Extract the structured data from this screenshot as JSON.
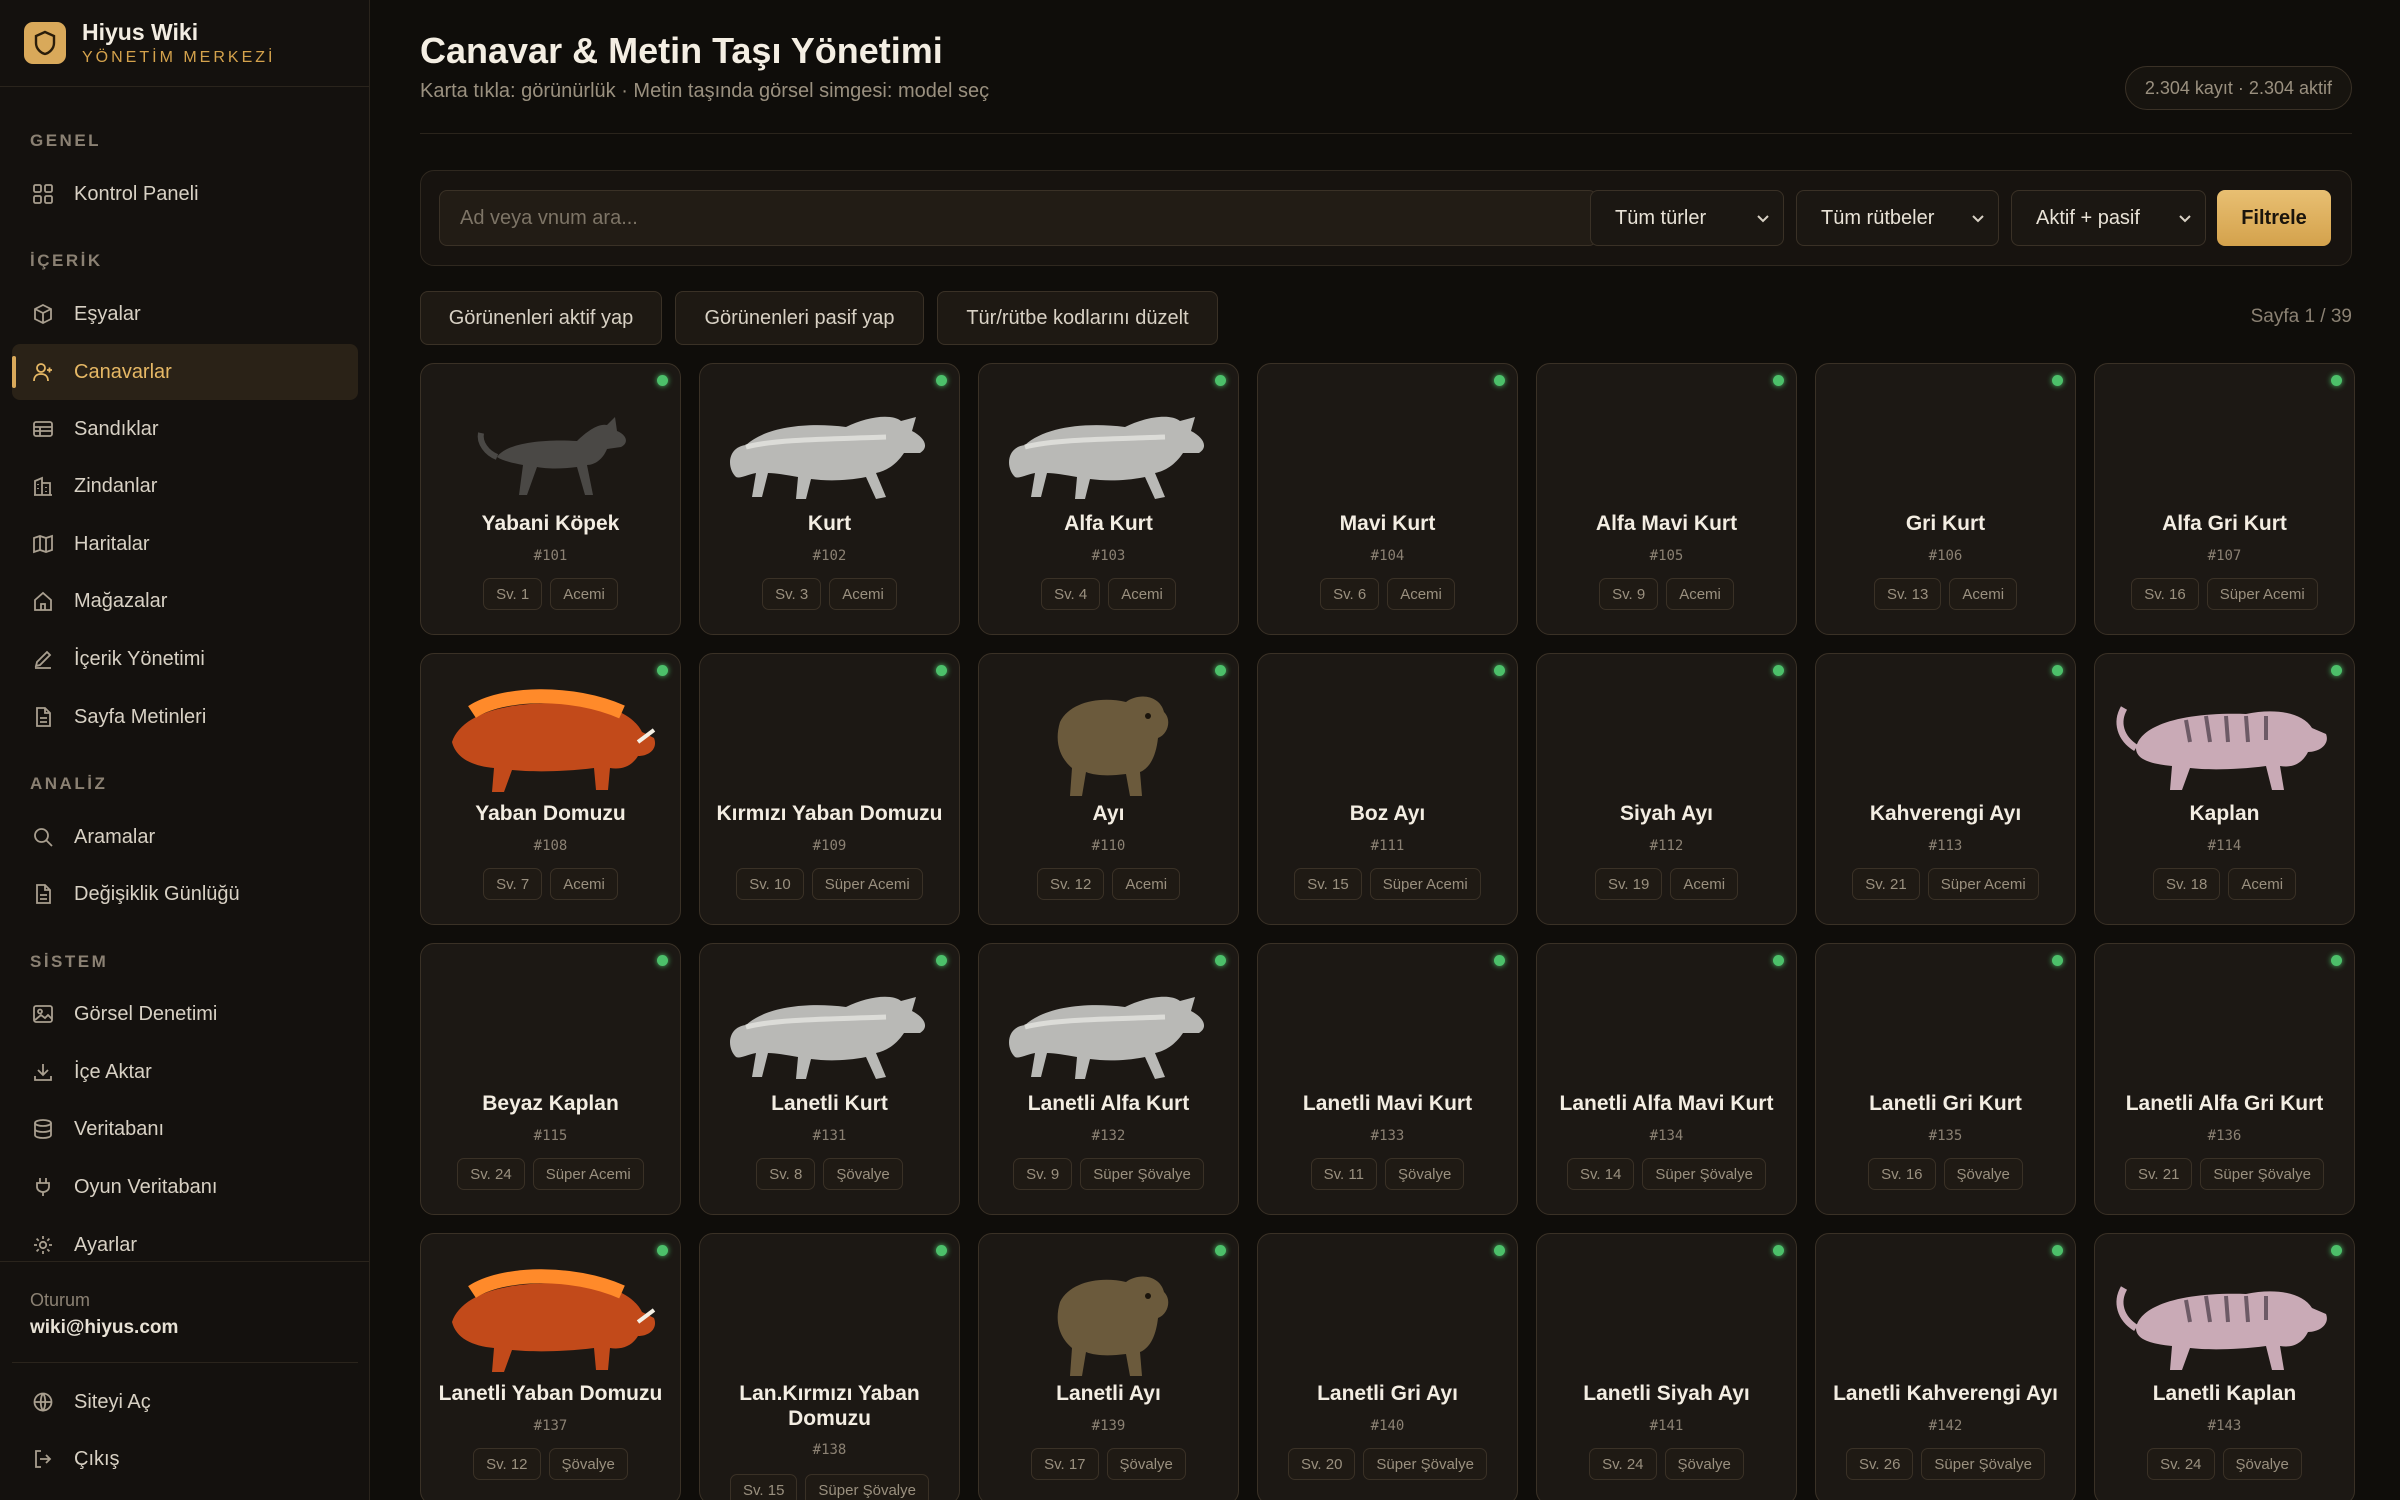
{
  "brand": {
    "title": "Hiyus Wiki",
    "subtitle": "YÖNETİM MERKEZİ"
  },
  "sidebar": {
    "sections": [
      "GENEL",
      "İÇERİK",
      "ANALİZ",
      "SİSTEM"
    ],
    "items": [
      {
        "label": "Kontrol Paneli",
        "icon": "grid-icon"
      },
      {
        "label": "Eşyalar",
        "icon": "box-icon"
      },
      {
        "label": "Canavarlar",
        "icon": "users-icon",
        "active": true
      },
      {
        "label": "Sandıklar",
        "icon": "chest-icon"
      },
      {
        "label": "Zindanlar",
        "icon": "building-icon"
      },
      {
        "label": "Haritalar",
        "icon": "map-icon"
      },
      {
        "label": "Mağazalar",
        "icon": "store-icon"
      },
      {
        "label": "İçerik Yönetimi",
        "icon": "pencil-icon"
      },
      {
        "label": "Sayfa Metinleri",
        "icon": "document-icon"
      },
      {
        "label": "Aramalar",
        "icon": "search-icon"
      },
      {
        "label": "Değişiklik Günlüğü",
        "icon": "document-icon"
      },
      {
        "label": "Görsel Denetimi",
        "icon": "image-icon"
      },
      {
        "label": "İçe Aktar",
        "icon": "download-icon"
      },
      {
        "label": "Veritabanı",
        "icon": "database-icon"
      },
      {
        "label": "Oyun Veritabanı",
        "icon": "plug-icon"
      },
      {
        "label": "Ayarlar",
        "icon": "gear-icon"
      }
    ],
    "session_label": "Oturum",
    "session_user": "wiki@hiyus.com",
    "bottom": [
      {
        "label": "Siteyi Aç",
        "icon": "globe-icon"
      },
      {
        "label": "Çıkış",
        "icon": "logout-icon"
      }
    ]
  },
  "header": {
    "title": "Canavar & Metin Taşı Yönetimi",
    "subtitle": "Karta tıkla: görünürlük · Metin taşında görsel simgesi: model seç",
    "count": "2.304 kayıt · 2.304 aktif"
  },
  "filters": {
    "search_placeholder": "Ad veya vnum ara...",
    "type": "Tüm türler",
    "rank": "Tüm rütbeler",
    "status": "Aktif + pasif",
    "submit": "Filtrele"
  },
  "actions": {
    "activate": "Görünenleri aktif yap",
    "deactivate": "Görünenleri pasif yap",
    "fix_codes": "Tür/rütbe kodlarını düzelt",
    "page": "Sayfa 1 / 39"
  },
  "colors": {
    "accent": "#d9a95a",
    "active_dot": "#4cc06a",
    "background": "#0f0d0a"
  },
  "monsters": [
    {
      "name": "Yabani Köpek",
      "vnum": "#101",
      "level": "Sv. 1",
      "rank": "Acemi",
      "art": "dog"
    },
    {
      "name": "Kurt",
      "vnum": "#102",
      "level": "Sv. 3",
      "rank": "Acemi",
      "art": "wolf"
    },
    {
      "name": "Alfa Kurt",
      "vnum": "#103",
      "level": "Sv. 4",
      "rank": "Acemi",
      "art": "wolf"
    },
    {
      "name": "Mavi Kurt",
      "vnum": "#104",
      "level": "Sv. 6",
      "rank": "Acemi",
      "art": "none"
    },
    {
      "name": "Alfa Mavi Kurt",
      "vnum": "#105",
      "level": "Sv. 9",
      "rank": "Acemi",
      "art": "none"
    },
    {
      "name": "Gri Kurt",
      "vnum": "#106",
      "level": "Sv. 13",
      "rank": "Acemi",
      "art": "none"
    },
    {
      "name": "Alfa Gri Kurt",
      "vnum": "#107",
      "level": "Sv. 16",
      "rank": "Süper Acemi",
      "art": "none"
    },
    {
      "name": "Yaban Domuzu",
      "vnum": "#108",
      "level": "Sv. 7",
      "rank": "Acemi",
      "art": "boar"
    },
    {
      "name": "Kırmızı Yaban Domuzu",
      "vnum": "#109",
      "level": "Sv. 10",
      "rank": "Süper Acemi",
      "art": "none"
    },
    {
      "name": "Ayı",
      "vnum": "#110",
      "level": "Sv. 12",
      "rank": "Acemi",
      "art": "bear"
    },
    {
      "name": "Boz Ayı",
      "vnum": "#111",
      "level": "Sv. 15",
      "rank": "Süper Acemi",
      "art": "none"
    },
    {
      "name": "Siyah Ayı",
      "vnum": "#112",
      "level": "Sv. 19",
      "rank": "Acemi",
      "art": "none"
    },
    {
      "name": "Kahverengi Ayı",
      "vnum": "#113",
      "level": "Sv. 21",
      "rank": "Süper Acemi",
      "art": "none"
    },
    {
      "name": "Kaplan",
      "vnum": "#114",
      "level": "Sv. 18",
      "rank": "Acemi",
      "art": "tiger"
    },
    {
      "name": "Beyaz Kaplan",
      "vnum": "#115",
      "level": "Sv. 24",
      "rank": "Süper Acemi",
      "art": "none"
    },
    {
      "name": "Lanetli Kurt",
      "vnum": "#131",
      "level": "Sv. 8",
      "rank": "Şövalye",
      "art": "wolf"
    },
    {
      "name": "Lanetli Alfa Kurt",
      "vnum": "#132",
      "level": "Sv. 9",
      "rank": "Süper Şövalye",
      "art": "wolf"
    },
    {
      "name": "Lanetli Mavi Kurt",
      "vnum": "#133",
      "level": "Sv. 11",
      "rank": "Şövalye",
      "art": "none"
    },
    {
      "name": "Lanetli Alfa Mavi Kurt",
      "vnum": "#134",
      "level": "Sv. 14",
      "rank": "Süper Şövalye",
      "art": "none"
    },
    {
      "name": "Lanetli Gri Kurt",
      "vnum": "#135",
      "level": "Sv. 16",
      "rank": "Şövalye",
      "art": "none"
    },
    {
      "name": "Lanetli Alfa Gri Kurt",
      "vnum": "#136",
      "level": "Sv. 21",
      "rank": "Süper Şövalye",
      "art": "none"
    },
    {
      "name": "Lanetli Yaban Domuzu",
      "vnum": "#137",
      "level": "Sv. 12",
      "rank": "Şövalye",
      "art": "boar"
    },
    {
      "name": "Lan.Kırmızı Yaban Domuzu",
      "vnum": "#138",
      "level": "Sv. 15",
      "rank": "Süper Şövalye",
      "art": "none"
    },
    {
      "name": "Lanetli Ayı",
      "vnum": "#139",
      "level": "Sv. 17",
      "rank": "Şövalye",
      "art": "bear"
    },
    {
      "name": "Lanetli Gri Ayı",
      "vnum": "#140",
      "level": "Sv. 20",
      "rank": "Süper Şövalye",
      "art": "none"
    },
    {
      "name": "Lanetli Siyah Ayı",
      "vnum": "#141",
      "level": "Sv. 24",
      "rank": "Şövalye",
      "art": "none"
    },
    {
      "name": "Lanetli Kahverengi Ayı",
      "vnum": "#142",
      "level": "Sv. 26",
      "rank": "Süper Şövalye",
      "art": "none"
    },
    {
      "name": "Lanetli Kaplan",
      "vnum": "#143",
      "level": "Sv. 24",
      "rank": "Şövalye",
      "art": "tiger"
    }
  ]
}
